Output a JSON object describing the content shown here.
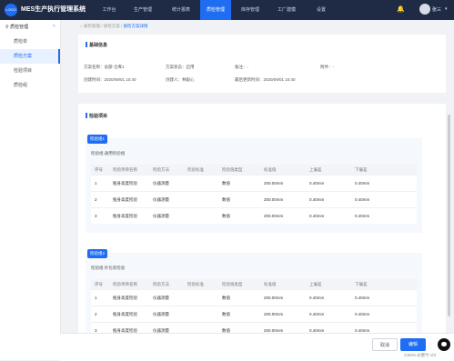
{
  "app": {
    "logo_text": "LOGO",
    "title": "MES生产执行管理系统"
  },
  "nav": [
    "工作台",
    "生产管理",
    "统计报表",
    "质检管理",
    "库存管理",
    "工厂建模",
    "设置"
  ],
  "user": {
    "name": "张三"
  },
  "sidebar": {
    "group": "质检管理",
    "items": [
      "质检单",
      "质检方案",
      "检验项目",
      "质检组"
    ]
  },
  "breadcrumb": {
    "a": "质检管理",
    "b": "质检方案",
    "c": "质检方案详情"
  },
  "basic": {
    "title": "基础信息",
    "scheme_name": "方案名称：总部-仓库1",
    "scheme_status": "方案状态：启用",
    "remark": "备注：-",
    "attachment": "附件：-",
    "created_time": "创建时间：2020/09/01 10:40",
    "creator": "创建人：林毅心",
    "updated_time": "最后更新时间：2020/09/01 10:40"
  },
  "items_title": "检验项目",
  "columns": [
    "序号",
    "检验项目名称",
    "检验方法",
    "检验标准",
    "检验值类型",
    "标准值",
    "上偏差",
    "下偏差"
  ],
  "groups": [
    {
      "tag": "检验组1",
      "name": "检验组:通用检验组",
      "rows": [
        [
          "1",
          "瓶身高度检验",
          "仪器测量",
          "",
          "数值",
          "200.00mm",
          "0.40mm",
          "0.40mm"
        ],
        [
          "2",
          "瓶身高度检验",
          "仪器测量",
          "",
          "数值",
          "200.00mm",
          "0.40mm",
          "0.40mm"
        ],
        [
          "3",
          "瓶身高度检验",
          "仪器测量",
          "",
          "数值",
          "200.00mm",
          "0.40mm",
          "0.40mm"
        ]
      ]
    },
    {
      "tag": "检验组2",
      "name": "检验组:外包装检验",
      "rows": [
        [
          "1",
          "瓶身高度检验",
          "仪器测量",
          "",
          "数值",
          "200.00mm",
          "0.40mm",
          "0.40mm"
        ],
        [
          "2",
          "瓶身高度检验",
          "仪器测量",
          "",
          "数值",
          "200.00mm",
          "0.40mm",
          "0.40mm"
        ],
        [
          "3",
          "瓶身高度检验",
          "仪器测量",
          "",
          "数值",
          "200.00mm",
          "0.40mm",
          "0.40mm"
        ]
      ]
    }
  ],
  "footer": {
    "cancel": "取消",
    "edit": "编辑"
  },
  "watermark": "CSDN @墨兮-zhl"
}
